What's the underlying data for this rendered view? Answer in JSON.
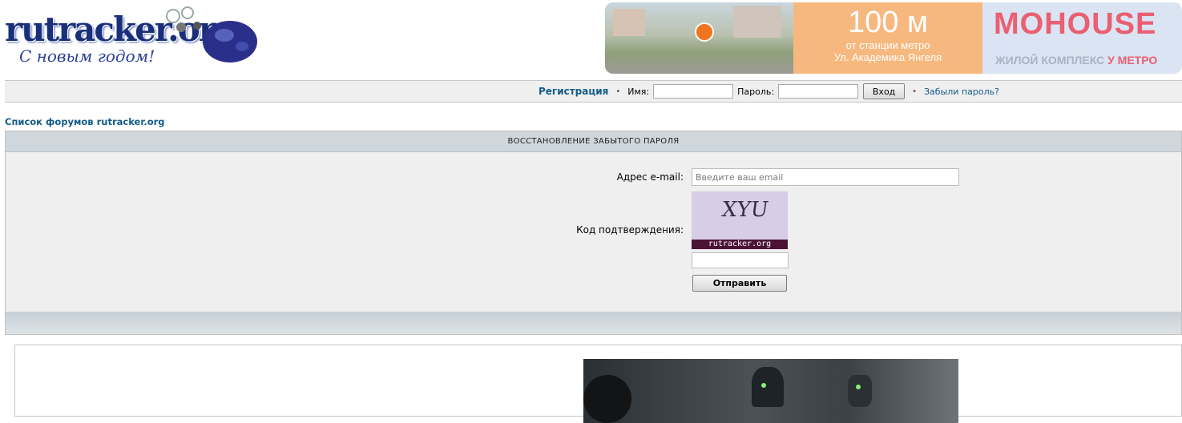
{
  "header": {
    "logo_text": "rutracker.org",
    "logo_subtitle": "С новым годом!"
  },
  "banner": {
    "distance": "100 м",
    "line1": "от станции метро",
    "line2": "Ул. Академика Янгеля",
    "brand": "MOHOUSE",
    "tagline_main": "ЖИЛОЙ КОМПЛЕКС",
    "tagline_accent": "У МЕТРО"
  },
  "login": {
    "register_label": "Регистрация",
    "name_label": "Имя:",
    "password_label": "Пароль:",
    "login_button": "Вход",
    "forgot_label": "Забыли пароль?",
    "name_value": "",
    "password_value": ""
  },
  "breadcrumb": "Список форумов rutracker.org",
  "form": {
    "title": "ВОССТАНОВЛЕНИЕ ЗАБЫТОГО ПАРОЛЯ",
    "email_label": "Адрес e-mail:",
    "email_placeholder": "Введите ваш email",
    "captcha_label": "Код подтверждения:",
    "captcha_code": "XYU",
    "captcha_caption": "rutracker.org",
    "captcha_value": "",
    "submit_label": "Отправить"
  },
  "colors": {
    "link": "#135c8a",
    "panel_header": "#d0d7dc",
    "panel_bg": "#efefef",
    "captcha_bg": "#d8cde6",
    "captcha_strip": "#4b1435"
  }
}
